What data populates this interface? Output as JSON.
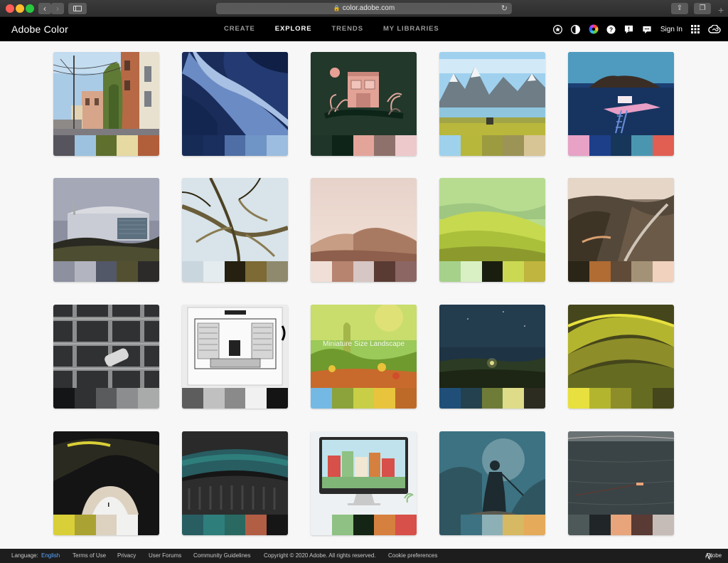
{
  "browser": {
    "url": "color.adobe.com"
  },
  "header": {
    "brand": "Adobe Color",
    "nav": [
      {
        "label": "CREATE",
        "active": false
      },
      {
        "label": "EXPLORE",
        "active": true
      },
      {
        "label": "TRENDS",
        "active": false
      },
      {
        "label": "MY LIBRARIES",
        "active": false
      }
    ],
    "icons": [
      "star-icon",
      "contrast-icon",
      "color-wheel-icon",
      "help-icon",
      "feedback-icon",
      "chat-icon"
    ],
    "sign_in": "Sign In"
  },
  "themes": [
    {
      "title": "",
      "swatches": [
        "#56545c",
        "#9cc2df",
        "#5e6f2e",
        "#e6d9a2",
        "#b15e3a"
      ]
    },
    {
      "title": "",
      "swatches": [
        "#172b57",
        "#1a2f5e",
        "#4e6ea5",
        "#6f94c6",
        "#9cbddf"
      ]
    },
    {
      "title": "",
      "swatches": [
        "#1f3529",
        "#0e2418",
        "#e3a59a",
        "#8e716b",
        "#edc9cb"
      ]
    },
    {
      "title": "",
      "swatches": [
        "#9ed1ec",
        "#b7b83b",
        "#9c9b40",
        "#9c9356",
        "#d8c596"
      ]
    },
    {
      "title": "",
      "swatches": [
        "#e7a2c6",
        "#1d3f8a",
        "#16365a",
        "#4a96b0",
        "#e05f52"
      ]
    },
    {
      "title": "",
      "swatches": [
        "#8d909f",
        "#b2b4c0",
        "#525868",
        "#535032",
        "#2d2b2a"
      ]
    },
    {
      "title": "",
      "swatches": [
        "#c9d6de",
        "#e4ecef",
        "#25200f",
        "#7d6a34",
        "#8f8a6d"
      ]
    },
    {
      "title": "",
      "swatches": [
        "#f0dfd6",
        "#b78470",
        "#d6c6c4",
        "#5a3b34",
        "#8c6663"
      ]
    },
    {
      "title": "",
      "swatches": [
        "#a5d18a",
        "#d8f0c3",
        "#1a1e0f",
        "#cbd952",
        "#c0b53e"
      ]
    },
    {
      "title": "",
      "swatches": [
        "#2a2517",
        "#b06c33",
        "#5f4b37",
        "#a49277",
        "#f1d2bf"
      ]
    },
    {
      "title": "",
      "swatches": [
        "#141517",
        "#303133",
        "#595b5d",
        "#8b8d8e",
        "#a9abab"
      ]
    },
    {
      "title": "",
      "swatches": [
        "#5d5d5d",
        "#c0c0c0",
        "#8a8a8a",
        "#f1f1f1",
        "#141414"
      ]
    },
    {
      "title": "Miniature Size Landscape",
      "swatches": [
        "#74b9e3",
        "#8ca23a",
        "#c8cf46",
        "#e7c43c",
        "#bd6a28"
      ]
    },
    {
      "title": "",
      "swatches": [
        "#1f4f78",
        "#24414f",
        "#6f7c38",
        "#dedc88",
        "#2c2c21"
      ]
    },
    {
      "title": "",
      "swatches": [
        "#e7e03e",
        "#b4b52f",
        "#8d8d2a",
        "#656c21",
        "#45461b"
      ]
    },
    {
      "title": "",
      "swatches": [
        "#d9cf38",
        "#aaa232",
        "#ddd1c0",
        "#f1f1f0",
        "#141414"
      ]
    },
    {
      "title": "",
      "swatches": [
        "#285d62",
        "#2e7e7c",
        "#296961",
        "#b25e45",
        "#161616"
      ]
    },
    {
      "title": "",
      "swatches": [
        "#eef1f3",
        "#8ec183",
        "#152515",
        "#d6803f",
        "#d75049"
      ]
    },
    {
      "title": "",
      "swatches": [
        "#2f5560",
        "#3c7282",
        "#8db0b7",
        "#d7b863",
        "#e5aa5a"
      ]
    },
    {
      "title": "",
      "swatches": [
        "#4d5858",
        "#202628",
        "#e8a47b",
        "#5a3a34",
        "#c6bcb7"
      ]
    }
  ],
  "footer": {
    "language_label": "Language:",
    "language_value": "English",
    "links": [
      "Terms of Use",
      "Privacy",
      "User Forums",
      "Community Guidelines",
      "Copyright © 2020 Adobe. All rights reserved.",
      "Cookie preferences"
    ],
    "logo_text": "Adobe"
  }
}
